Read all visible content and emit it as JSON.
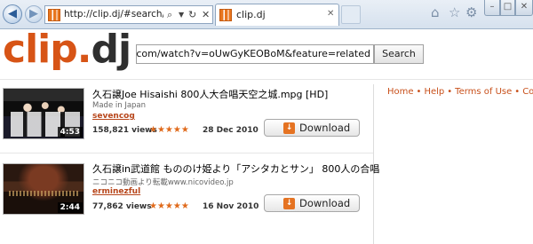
{
  "browser": {
    "address": "http://clip.dj/#search/http://",
    "tab_title": "clip.dj",
    "icons": [
      "back-arrow",
      "forward-arrow",
      "search",
      "dropdown",
      "refresh",
      "stop",
      "home",
      "star",
      "gear"
    ]
  },
  "site": {
    "logo_part1": "clip",
    "logo_dot": ".",
    "logo_part2": "dj",
    "search_value": "w.youtube.com/watch?v=oUwGyKEOBoM&feature=related",
    "search_button": "Search"
  },
  "nav": {
    "items": [
      "Home",
      "Help",
      "Terms of Use",
      "Conta"
    ],
    "bullet": "•"
  },
  "videos": [
    {
      "title": "久石譲Joe Hisaishi 800人大合唱天空之城.mpg [HD]",
      "description": "Made in Japan",
      "user": "sevencog",
      "views": "158,821 views",
      "stars": "★★★★★",
      "date": "28 Dec 2010",
      "duration": "4:53",
      "download_label": "Download"
    },
    {
      "title": "久石譲in武道館 もののけ姫より「アシタカとサン」 800人の合唱",
      "description": "ニコニコ動画より転載www.nicovideo.jp",
      "user": "erminezful",
      "views": "77,862 views",
      "stars": "★★★★★",
      "date": "16 Nov 2010",
      "duration": "2:44",
      "download_label": "Download"
    }
  ],
  "colors": {
    "accent": "#d75416",
    "link": "#c8501b"
  }
}
